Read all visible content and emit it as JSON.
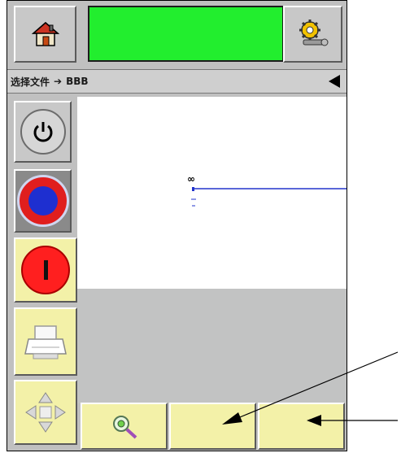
{
  "header": {
    "status_text": "",
    "status_color": "#22ee2e"
  },
  "path": {
    "parent_label": "选择文件",
    "arrow": "➔",
    "current_label": "BBB"
  },
  "canvas": {
    "infinity_glyph": "∞"
  },
  "sidebar": {
    "power_color": "#6c6c6c",
    "stop_color": "#1e2fd0",
    "start_color": "#ff1f1f"
  },
  "bottom_bar": {
    "button1_label": "",
    "button2_label": "",
    "button3_label": ""
  },
  "colors": {
    "frame": "#c0c0c0",
    "button_yellow": "#f3f1a8",
    "canvas_line": "#2233cc"
  }
}
